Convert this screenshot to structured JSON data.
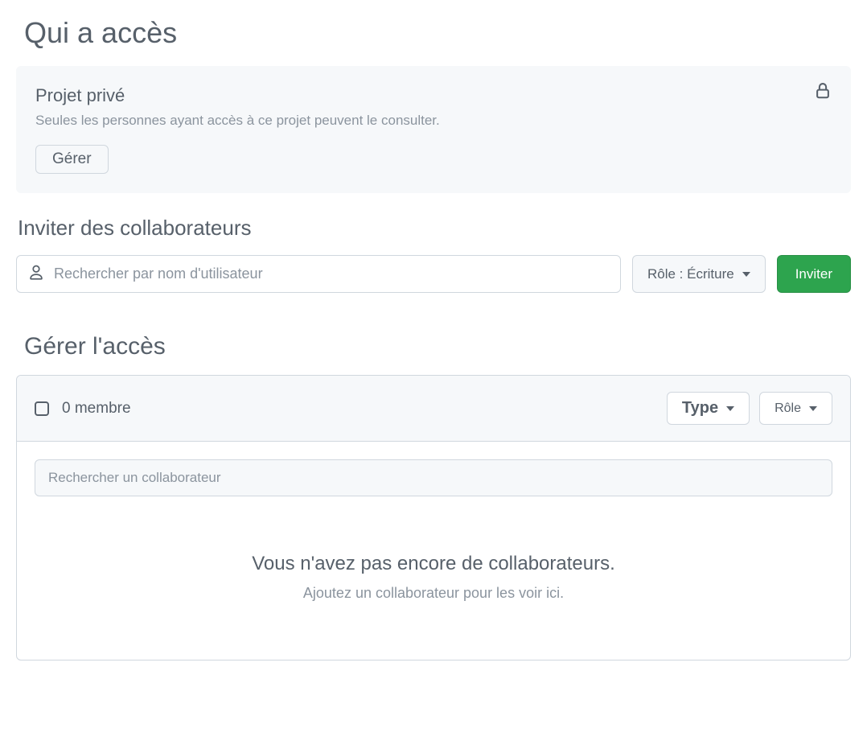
{
  "page": {
    "title": "Qui a accès"
  },
  "visibility": {
    "title": "Projet privé",
    "description": "Seules les personnes ayant accès à ce projet peuvent le consulter.",
    "manage_label": "Gérer"
  },
  "invite": {
    "title": "Inviter des collaborateurs",
    "search_placeholder": "Rechercher par nom d'utilisateur",
    "role_label": "Rôle : Écriture",
    "invite_button": "Inviter"
  },
  "manage": {
    "title": "Gérer l'accès",
    "member_count": "0 membre",
    "type_filter": "Type",
    "role_filter": "Rôle",
    "search_placeholder": "Rechercher un collaborateur",
    "empty_title": "Vous n'avez pas encore de collaborateurs.",
    "empty_sub": "Ajoutez un collaborateur pour les voir ici."
  }
}
